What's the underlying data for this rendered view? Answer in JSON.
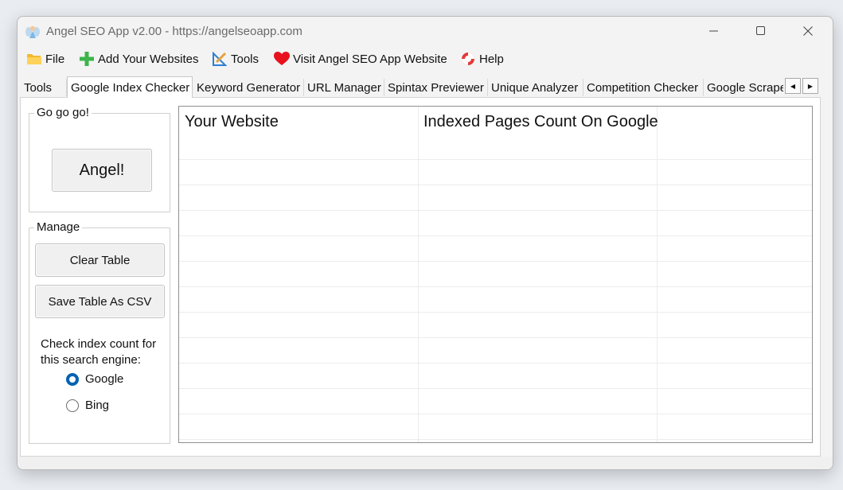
{
  "window": {
    "title": "Angel SEO App v2.00 - https://angelseoapp.com"
  },
  "controls": {
    "minimize": "—",
    "maximize": "☐",
    "close": "✕"
  },
  "menu": [
    {
      "label": "File",
      "icon": "folder-icon"
    },
    {
      "label": "Add Your Websites",
      "icon": "plus-icon"
    },
    {
      "label": "Tools",
      "icon": "tools-icon"
    },
    {
      "label": "Visit Angel SEO App Website",
      "icon": "heart-icon"
    },
    {
      "label": "Help",
      "icon": "lifebuoy-icon"
    }
  ],
  "tabs": [
    {
      "label": "Tools",
      "active": false
    },
    {
      "label": "Google Index Checker",
      "active": true
    },
    {
      "label": "Keyword Generator",
      "active": false
    },
    {
      "label": "URL Manager",
      "active": false
    },
    {
      "label": "Spintax Previewer",
      "active": false
    },
    {
      "label": "Unique Analyzer",
      "active": false
    },
    {
      "label": "Competition Checker",
      "active": false
    },
    {
      "label": "Google Scrape",
      "active": false
    }
  ],
  "tab_scroll": {
    "left": "◀",
    "right": "▶"
  },
  "go_group": {
    "title": "Go go go!",
    "button": "Angel!"
  },
  "manage_group": {
    "title": "Manage",
    "clear_button": "Clear Table",
    "save_button": "Save Table As CSV",
    "engine_label": "Check index count for this search engine:",
    "engines": [
      {
        "label": "Google",
        "selected": true
      },
      {
        "label": "Bing",
        "selected": false
      }
    ]
  },
  "table": {
    "columns": [
      "Your Website",
      "Indexed Pages Count On Google",
      ""
    ],
    "rows": []
  },
  "colors": {
    "accent": "#0063b1",
    "heart": "#e8121c",
    "plus": "#3cb54a",
    "folder": "#f5b82e"
  }
}
